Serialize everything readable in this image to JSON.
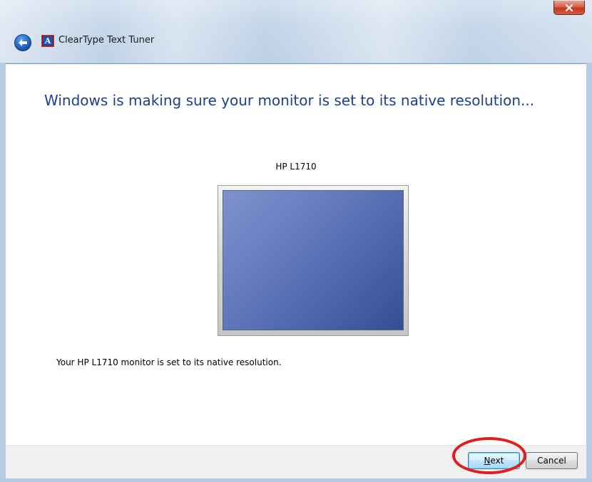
{
  "window": {
    "title": "ClearType Text Tuner",
    "close_icon": "close-icon",
    "back_icon": "back-arrow-icon",
    "app_icon": "cleartype-app-icon",
    "app_icon_glyph": "A"
  },
  "main": {
    "heading": "Windows is making sure your monitor is set to its native resolution...",
    "monitor_name": "HP L1710",
    "monitor_icon": "monitor-icon",
    "status_text": "Your HP L1710 monitor is set to its native resolution."
  },
  "footer": {
    "next_label_accel": "N",
    "next_label_rest": "ext",
    "cancel_label": "Cancel"
  },
  "colors": {
    "heading": "#1e3f8a",
    "highlight_ring": "#e31c1c",
    "screen_top": "#7f92cd",
    "screen_bottom": "#334f93"
  }
}
